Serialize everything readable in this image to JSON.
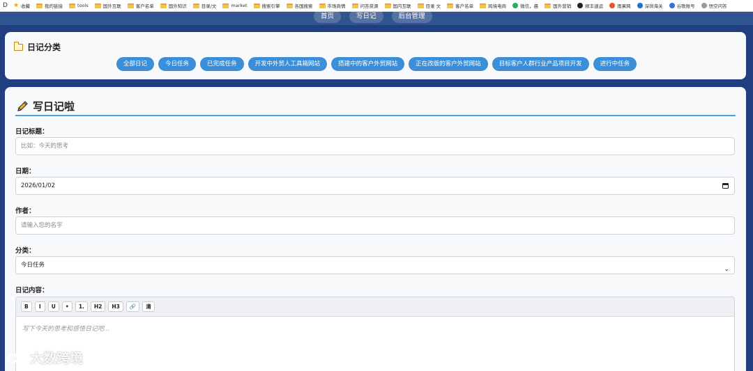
{
  "bookmarks": {
    "toggle": "D",
    "items": [
      {
        "label": "收藏",
        "icon": "star-icon"
      },
      {
        "label": "我的链接",
        "icon": "folder-icon"
      },
      {
        "label": "tools",
        "icon": "folder-icon"
      },
      {
        "label": "国外互联",
        "icon": "folder-icon"
      },
      {
        "label": "客户名单",
        "icon": "folder-icon"
      },
      {
        "label": "国外知识",
        "icon": "folder-icon"
      },
      {
        "label": "目录/文",
        "icon": "folder-icon"
      },
      {
        "label": "market",
        "icon": "folder-icon"
      },
      {
        "label": "搜索引擎",
        "icon": "folder-icon"
      },
      {
        "label": "各国搜索",
        "icon": "folder-icon"
      },
      {
        "label": "市场商情",
        "icon": "folder-icon"
      },
      {
        "label": "问答资源",
        "icon": "folder-icon"
      },
      {
        "label": "国内互联",
        "icon": "folder-icon"
      },
      {
        "label": "目录 文",
        "icon": "folder-icon"
      },
      {
        "label": "客户名单",
        "icon": "folder-icon"
      },
      {
        "label": "跨境电商",
        "icon": "folder-icon"
      },
      {
        "label": "微信，晨",
        "icon": "wechat-icon"
      },
      {
        "label": "国外营销",
        "icon": "folder-icon"
      },
      {
        "label": "顺丰速运",
        "icon": "sf-express-icon"
      },
      {
        "label": "雨果网",
        "icon": "cifnews-icon"
      },
      {
        "label": "深圳海关",
        "icon": "customs-icon"
      },
      {
        "label": "谷歌账号",
        "icon": "google-account-icon"
      },
      {
        "label": "悟空问答",
        "icon": "wukong-icon"
      }
    ]
  },
  "nav": {
    "items": [
      "首页",
      "写日记",
      "后台管理"
    ]
  },
  "categories": {
    "title": "日记分类",
    "items": [
      "全部日记",
      "今日任务",
      "已完成任务",
      "开发中外贸人工具箱网站",
      "搭建中的客户外贸网站",
      "正在改版的客户外贸网站",
      "目标客户人群行业产品项目开发",
      "进行中任务"
    ]
  },
  "form": {
    "heading": "写日记啦",
    "title_label": "日记标题：",
    "title_placeholder": "比如：今天的思考",
    "date_label": "日期：",
    "date_value": "2026/01/02",
    "author_label": "作者：",
    "author_placeholder": "请输入您的名字",
    "category_label": "分类：",
    "category_value": "今日任务",
    "content_label": "日记内容：",
    "toolbar": [
      "B",
      "I",
      "U",
      "•",
      "1.",
      "H2",
      "H3",
      "🔗",
      "清"
    ],
    "content_placeholder": "写下今天的思考和感悟日记吧..."
  },
  "watermark": "大数跨境"
}
